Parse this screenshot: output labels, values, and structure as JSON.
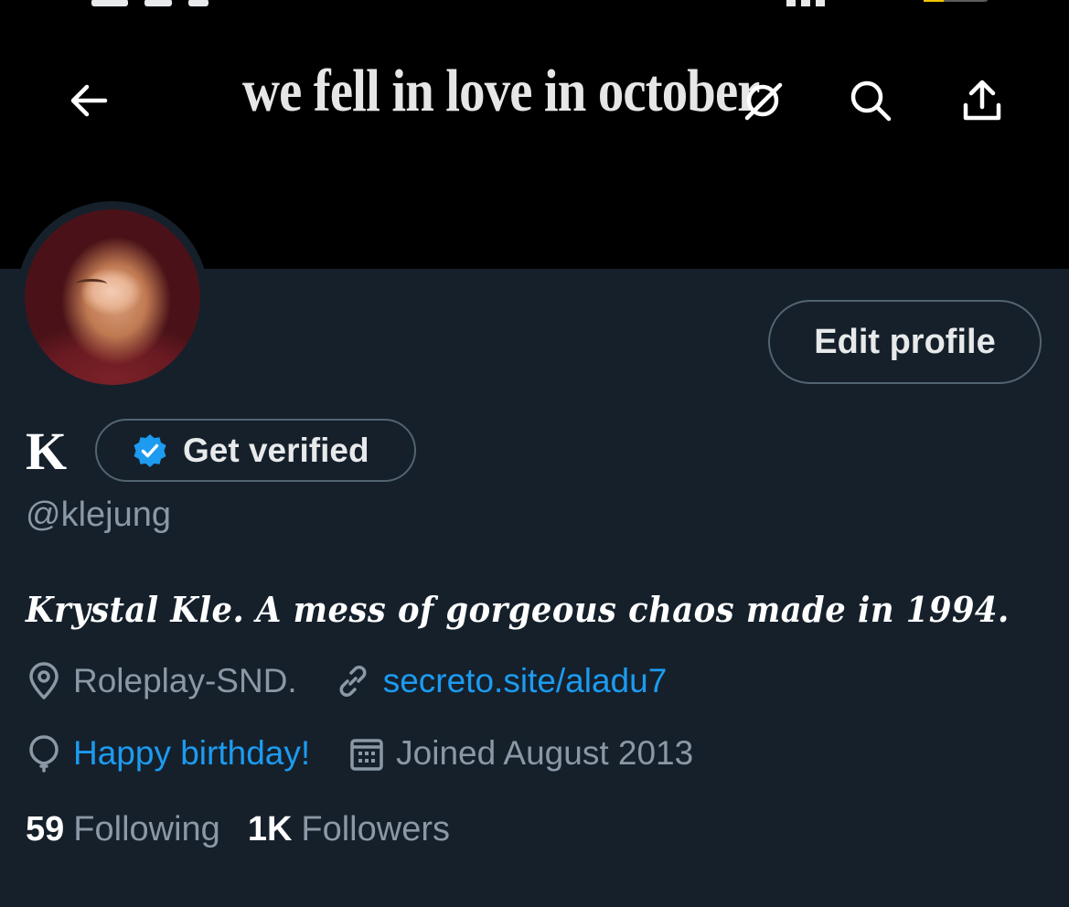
{
  "banner": {
    "text": "we fell in love in october"
  },
  "nav": {
    "back_icon": "arrow-left-icon",
    "grok_icon": "grok-icon",
    "search_icon": "search-icon",
    "share_icon": "share-icon"
  },
  "profile": {
    "display_name": "K",
    "get_verified_label": "Get verified",
    "handle": "@klejung",
    "edit_profile_label": "Edit profile",
    "bio": "Krystal Kle. A mess of gorgeous chaos made in 1994.",
    "location": "Roleplay-SND.",
    "website": "secreto.site/aladu7",
    "birthday": "Happy birthday!",
    "joined": "Joined August 2013",
    "following_count": "59",
    "following_label": "Following",
    "followers_count": "1K",
    "followers_label": "Followers"
  },
  "colors": {
    "background": "#15202b",
    "banner": "#000000",
    "accent": "#1d9bf0",
    "secondary_text": "#8b98a5",
    "border": "#536471"
  }
}
